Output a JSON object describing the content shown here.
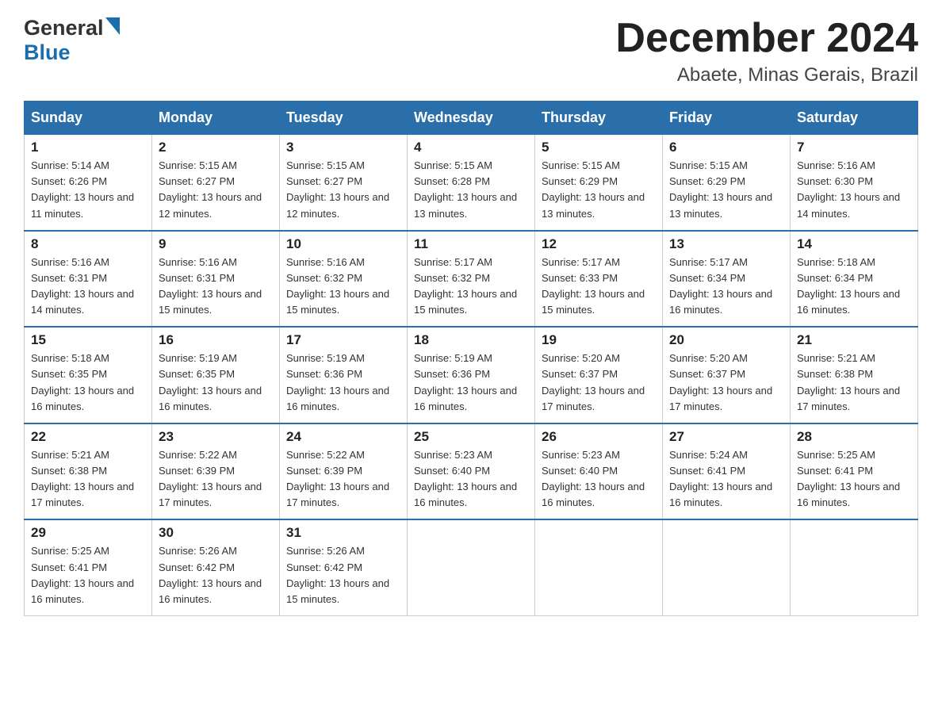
{
  "logo": {
    "general": "General",
    "blue": "Blue"
  },
  "header": {
    "month": "December 2024",
    "location": "Abaete, Minas Gerais, Brazil"
  },
  "weekdays": [
    "Sunday",
    "Monday",
    "Tuesday",
    "Wednesday",
    "Thursday",
    "Friday",
    "Saturday"
  ],
  "weeks": [
    [
      {
        "day": "1",
        "sunrise": "5:14 AM",
        "sunset": "6:26 PM",
        "daylight": "13 hours and 11 minutes."
      },
      {
        "day": "2",
        "sunrise": "5:15 AM",
        "sunset": "6:27 PM",
        "daylight": "13 hours and 12 minutes."
      },
      {
        "day": "3",
        "sunrise": "5:15 AM",
        "sunset": "6:27 PM",
        "daylight": "13 hours and 12 minutes."
      },
      {
        "day": "4",
        "sunrise": "5:15 AM",
        "sunset": "6:28 PM",
        "daylight": "13 hours and 13 minutes."
      },
      {
        "day": "5",
        "sunrise": "5:15 AM",
        "sunset": "6:29 PM",
        "daylight": "13 hours and 13 minutes."
      },
      {
        "day": "6",
        "sunrise": "5:15 AM",
        "sunset": "6:29 PM",
        "daylight": "13 hours and 13 minutes."
      },
      {
        "day": "7",
        "sunrise": "5:16 AM",
        "sunset": "6:30 PM",
        "daylight": "13 hours and 14 minutes."
      }
    ],
    [
      {
        "day": "8",
        "sunrise": "5:16 AM",
        "sunset": "6:31 PM",
        "daylight": "13 hours and 14 minutes."
      },
      {
        "day": "9",
        "sunrise": "5:16 AM",
        "sunset": "6:31 PM",
        "daylight": "13 hours and 15 minutes."
      },
      {
        "day": "10",
        "sunrise": "5:16 AM",
        "sunset": "6:32 PM",
        "daylight": "13 hours and 15 minutes."
      },
      {
        "day": "11",
        "sunrise": "5:17 AM",
        "sunset": "6:32 PM",
        "daylight": "13 hours and 15 minutes."
      },
      {
        "day": "12",
        "sunrise": "5:17 AM",
        "sunset": "6:33 PM",
        "daylight": "13 hours and 15 minutes."
      },
      {
        "day": "13",
        "sunrise": "5:17 AM",
        "sunset": "6:34 PM",
        "daylight": "13 hours and 16 minutes."
      },
      {
        "day": "14",
        "sunrise": "5:18 AM",
        "sunset": "6:34 PM",
        "daylight": "13 hours and 16 minutes."
      }
    ],
    [
      {
        "day": "15",
        "sunrise": "5:18 AM",
        "sunset": "6:35 PM",
        "daylight": "13 hours and 16 minutes."
      },
      {
        "day": "16",
        "sunrise": "5:19 AM",
        "sunset": "6:35 PM",
        "daylight": "13 hours and 16 minutes."
      },
      {
        "day": "17",
        "sunrise": "5:19 AM",
        "sunset": "6:36 PM",
        "daylight": "13 hours and 16 minutes."
      },
      {
        "day": "18",
        "sunrise": "5:19 AM",
        "sunset": "6:36 PM",
        "daylight": "13 hours and 16 minutes."
      },
      {
        "day": "19",
        "sunrise": "5:20 AM",
        "sunset": "6:37 PM",
        "daylight": "13 hours and 17 minutes."
      },
      {
        "day": "20",
        "sunrise": "5:20 AM",
        "sunset": "6:37 PM",
        "daylight": "13 hours and 17 minutes."
      },
      {
        "day": "21",
        "sunrise": "5:21 AM",
        "sunset": "6:38 PM",
        "daylight": "13 hours and 17 minutes."
      }
    ],
    [
      {
        "day": "22",
        "sunrise": "5:21 AM",
        "sunset": "6:38 PM",
        "daylight": "13 hours and 17 minutes."
      },
      {
        "day": "23",
        "sunrise": "5:22 AM",
        "sunset": "6:39 PM",
        "daylight": "13 hours and 17 minutes."
      },
      {
        "day": "24",
        "sunrise": "5:22 AM",
        "sunset": "6:39 PM",
        "daylight": "13 hours and 17 minutes."
      },
      {
        "day": "25",
        "sunrise": "5:23 AM",
        "sunset": "6:40 PM",
        "daylight": "13 hours and 16 minutes."
      },
      {
        "day": "26",
        "sunrise": "5:23 AM",
        "sunset": "6:40 PM",
        "daylight": "13 hours and 16 minutes."
      },
      {
        "day": "27",
        "sunrise": "5:24 AM",
        "sunset": "6:41 PM",
        "daylight": "13 hours and 16 minutes."
      },
      {
        "day": "28",
        "sunrise": "5:25 AM",
        "sunset": "6:41 PM",
        "daylight": "13 hours and 16 minutes."
      }
    ],
    [
      {
        "day": "29",
        "sunrise": "5:25 AM",
        "sunset": "6:41 PM",
        "daylight": "13 hours and 16 minutes."
      },
      {
        "day": "30",
        "sunrise": "5:26 AM",
        "sunset": "6:42 PM",
        "daylight": "13 hours and 16 minutes."
      },
      {
        "day": "31",
        "sunrise": "5:26 AM",
        "sunset": "6:42 PM",
        "daylight": "13 hours and 15 minutes."
      },
      null,
      null,
      null,
      null
    ]
  ],
  "labels": {
    "sunrise": "Sunrise:",
    "sunset": "Sunset:",
    "daylight": "Daylight:"
  },
  "colors": {
    "header_bg": "#2a6eaa",
    "header_text": "#ffffff",
    "accent": "#1a6eab"
  }
}
